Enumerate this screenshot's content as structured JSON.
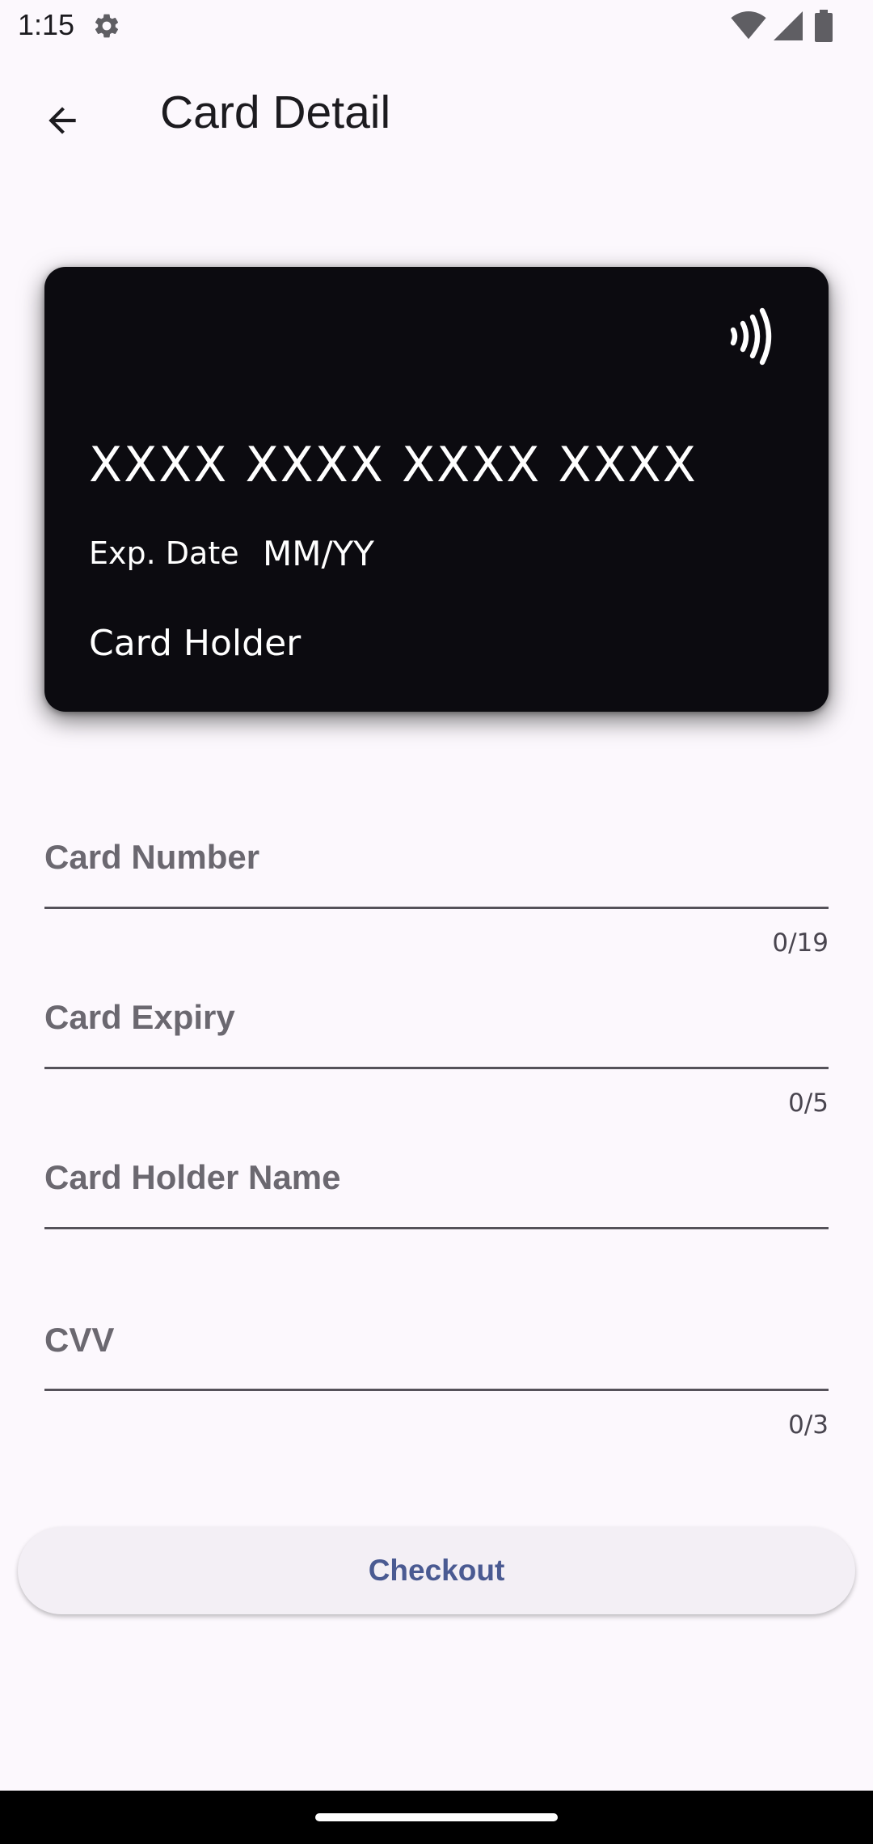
{
  "status_bar": {
    "time": "1:15",
    "icons": [
      "gear-icon",
      "wifi-icon",
      "signal-icon",
      "battery-icon"
    ]
  },
  "app_bar": {
    "back_icon": "arrow-back-icon",
    "title": "Card Detail"
  },
  "card": {
    "background_color": "#0c0b10",
    "nfc_icon": "contactless-icon",
    "number": "XXXX XXXX XXXX XXXX",
    "exp_label": "Exp. Date",
    "exp_value": "MM/YY",
    "holder": "Card Holder"
  },
  "form": {
    "card_number": {
      "label": "Card Number",
      "counter": "0/19"
    },
    "card_expiry": {
      "label": "Card Expiry",
      "counter": "0/5"
    },
    "card_holder_name": {
      "label": "Card Holder Name"
    },
    "cvv": {
      "label": "CVV",
      "counter": "0/3"
    }
  },
  "checkout": {
    "label": "Checkout",
    "text_color": "#4a5a92"
  }
}
